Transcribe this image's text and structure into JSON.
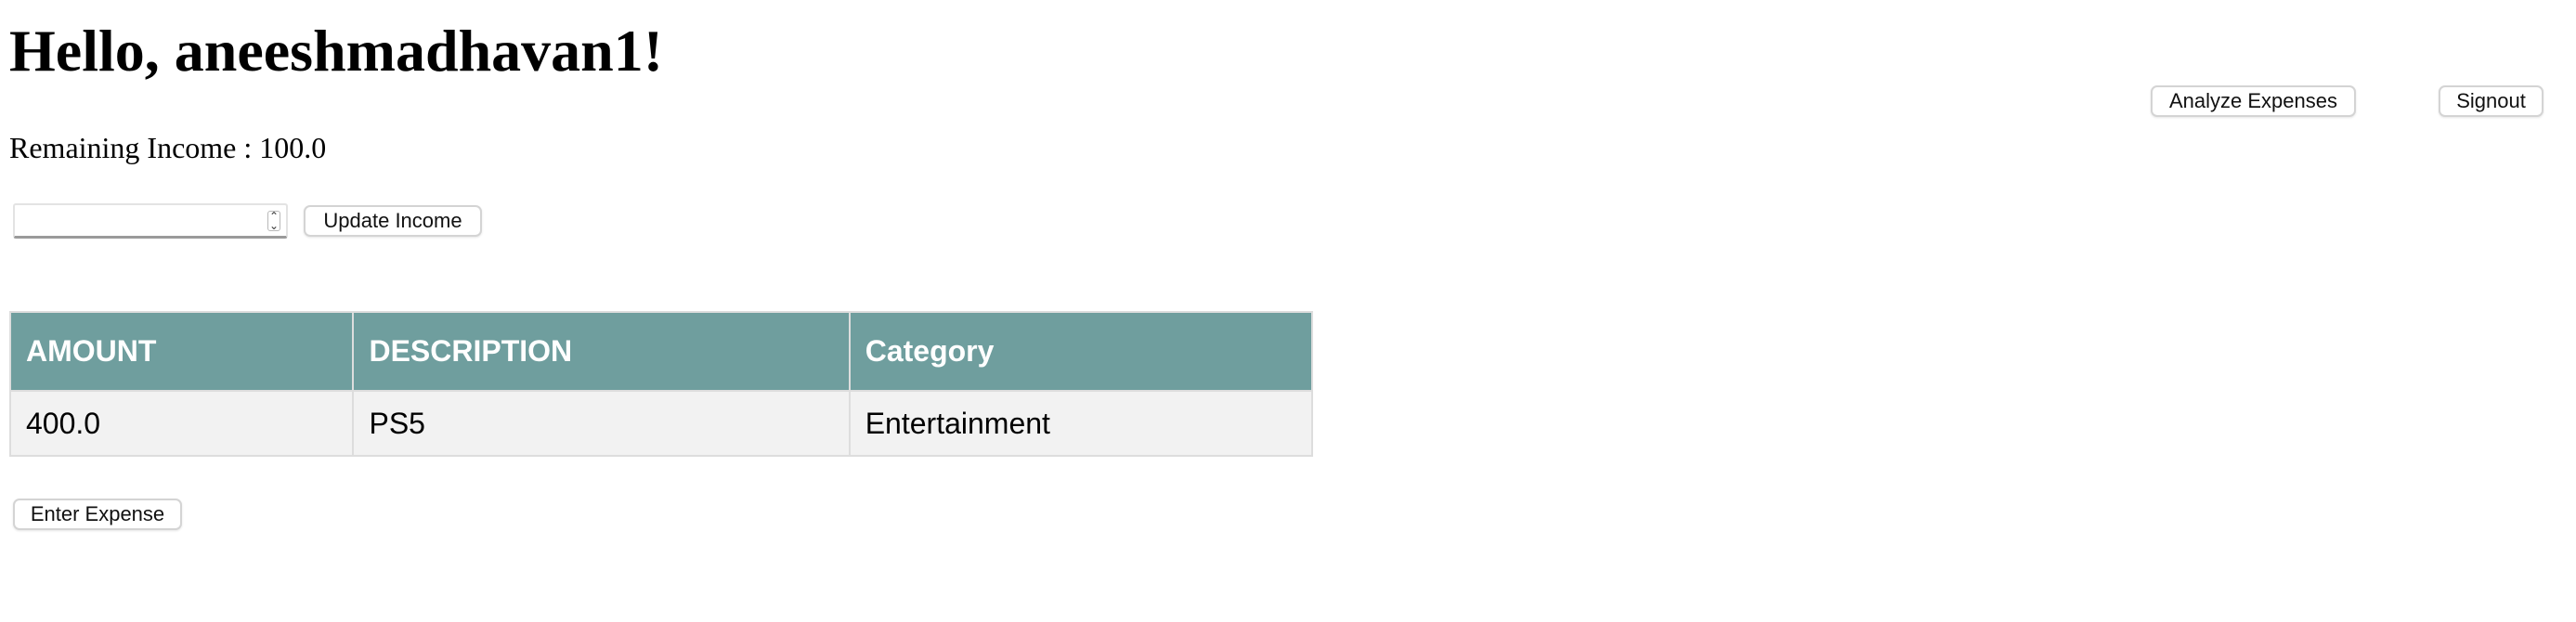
{
  "header": {
    "greeting": "Hello, aneeshmadhavan1!",
    "analyze_label": "Analyze Expenses",
    "signout_label": "Signout"
  },
  "income": {
    "label": "Remaining Income : 100.0",
    "input_value": "",
    "update_label": "Update Income"
  },
  "expenses": {
    "columns": [
      "AMOUNT",
      "DESCRIPTION",
      "Category"
    ],
    "rows": [
      {
        "amount": "400.0",
        "description": "PS5",
        "category": "Entertainment"
      }
    ]
  },
  "actions": {
    "enter_expense_label": "Enter Expense"
  },
  "colors": {
    "table_header_bg": "#6f9e9e",
    "table_row_bg": "#f2f2f2"
  }
}
